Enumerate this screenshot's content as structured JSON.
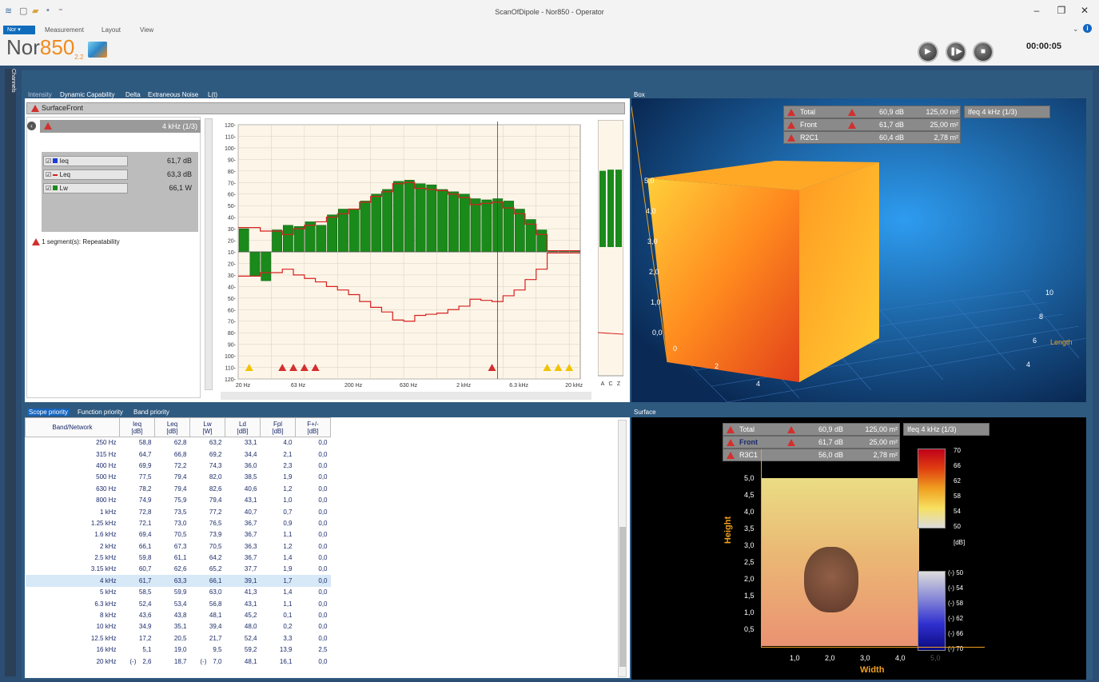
{
  "window": {
    "title": "ScanOfDipole - Nor850 - Operator"
  },
  "menu": {
    "app": "Nor",
    "items": [
      "Measurement",
      "Layout",
      "View"
    ]
  },
  "logo": {
    "text_a": "Nor",
    "text_b": "850",
    "version": "2.2"
  },
  "transport": {
    "timer": "00:00:05"
  },
  "sidebar": {
    "channels_label": "Channels"
  },
  "left_panel": {
    "tabs": [
      "Intensity",
      "Dynamic Capability",
      "Delta",
      "Extraneous Noise",
      "L(t)"
    ],
    "surface": "SurfaceFront",
    "band": "4 kHz (1/3)",
    "legend": [
      {
        "name": "Ieq",
        "value": "61,7 dB",
        "color": "#1f3bd9"
      },
      {
        "name": "Leq",
        "value": "63,3 dB",
        "color": "#d62020"
      },
      {
        "name": "Lw",
        "value": "66,1 W",
        "color": "#1a8a1a"
      }
    ],
    "repeatability": "1 segment(s): Repeatability"
  },
  "chart_data": {
    "type": "bar",
    "y_ticks": [
      "120",
      "110",
      "100",
      "90",
      "80",
      "70",
      "60",
      "50",
      "40",
      "30",
      "20",
      "10",
      "20",
      "30",
      "40",
      "50",
      "60",
      "70",
      "80",
      "90",
      "100",
      "110",
      "120"
    ],
    "x_ticks": [
      "20 Hz",
      "63 Hz",
      "200 Hz",
      "630 Hz",
      "2 kHz",
      "6.3 kHz",
      "20 kHz"
    ],
    "bands": [
      "20",
      "25",
      "31.5",
      "40",
      "50",
      "63",
      "80",
      "100",
      "125",
      "160",
      "200",
      "250",
      "315",
      "400",
      "500",
      "630",
      "800",
      "1k",
      "1.25k",
      "1.6k",
      "2k",
      "2.5k",
      "3.15k",
      "4k",
      "5k",
      "6.3k",
      "8k",
      "10k",
      "12.5k",
      "16k",
      "20k"
    ],
    "intensity": [
      40,
      -41,
      -45,
      39,
      43,
      42,
      46,
      43,
      52,
      57,
      57,
      64,
      70,
      74,
      81,
      82,
      79,
      78,
      74,
      72,
      70,
      66,
      65,
      66,
      64,
      57,
      48,
      39,
      21,
      21,
      21
    ],
    "pressure": [
      41,
      41,
      38,
      38,
      35,
      40,
      43,
      46,
      50,
      53,
      57,
      63,
      68,
      72,
      79,
      80,
      75,
      74,
      73,
      70,
      67,
      61,
      62,
      63,
      58,
      53,
      44,
      35,
      21,
      21,
      21
    ],
    "mini_labels": [
      "A",
      "C",
      "Z"
    ],
    "mini_values": [
      86,
      87,
      87
    ]
  },
  "box_panel": {
    "tab": "Box",
    "rows": [
      {
        "label": "Total",
        "value": "60,9 dB",
        "area": "125,00 m²"
      },
      {
        "label": "Front",
        "value": "61,7 dB",
        "area": "25,00 m²"
      },
      {
        "label": "R2C1",
        "value": "60,4 dB",
        "area": "2,78 m²"
      }
    ],
    "metric": "Ifeq 4 kHz (1/3)",
    "y_axis": [
      "0,0",
      "1,0",
      "2,0",
      "3,0",
      "4,0",
      "5,0"
    ],
    "x_axis": [
      "0",
      "2",
      "4"
    ],
    "z_axis": [
      "10",
      "8",
      "6",
      "4"
    ],
    "z_label": "Length"
  },
  "surface_panel": {
    "tab": "Surface",
    "rows": [
      {
        "label": "Total",
        "value": "60,9 dB",
        "area": "125,00 m²"
      },
      {
        "label": "Front",
        "value": "61,7 dB",
        "area": "25,00 m²"
      },
      {
        "label": "R3C1",
        "value": "56,0 dB",
        "area": "2,78 m²"
      }
    ],
    "metric": "Ifeq 4 kHz (1/3)",
    "y_axis": [
      "5,0",
      "4,5",
      "4,0",
      "3,5",
      "3,0",
      "2,5",
      "2,0",
      "1,5",
      "1,0",
      "0,5"
    ],
    "x_axis": [
      "1,0",
      "2,0",
      "3,0",
      "4,0",
      "5,0"
    ],
    "x_label": "Width",
    "y_label": "Height",
    "scale_pos": [
      "70",
      "66",
      "62",
      "58",
      "54",
      "50"
    ],
    "scale_unit": "[dB]",
    "scale_neg": [
      "(-) 50",
      "(-) 54",
      "(-) 58",
      "(-) 62",
      "(-) 66",
      "(-) 70"
    ]
  },
  "table": {
    "tabs": [
      "Scope priority",
      "Function priority",
      "Band priority"
    ],
    "headers": [
      "Band/Network",
      "Ieq\n[dB]",
      "Leq\n[dB]",
      "Lw\n[W]",
      "Ld\n[dB]",
      "Fpl\n[dB]",
      "F+/-\n[dB]"
    ],
    "rows": [
      [
        "250 Hz",
        "",
        "58,8",
        "62,8",
        "",
        "63,2",
        "33,1",
        "4,0",
        "0,0"
      ],
      [
        "315 Hz",
        "",
        "64,7",
        "66,8",
        "",
        "69,2",
        "34,4",
        "2,1",
        "0,0"
      ],
      [
        "400 Hz",
        "",
        "69,9",
        "72,2",
        "",
        "74,3",
        "36,0",
        "2,3",
        "0,0"
      ],
      [
        "500 Hz",
        "",
        "77,5",
        "79,4",
        "",
        "82,0",
        "38,5",
        "1,9",
        "0,0"
      ],
      [
        "630 Hz",
        "",
        "78,2",
        "79,4",
        "",
        "82,6",
        "40,6",
        "1,2",
        "0,0"
      ],
      [
        "800 Hz",
        "",
        "74,9",
        "75,9",
        "",
        "79,4",
        "43,1",
        "1,0",
        "0,0"
      ],
      [
        "1 kHz",
        "",
        "72,8",
        "73,5",
        "",
        "77,2",
        "40,7",
        "0,7",
        "0,0"
      ],
      [
        "1.25 kHz",
        "",
        "72,1",
        "73,0",
        "",
        "76,5",
        "36,7",
        "0,9",
        "0,0"
      ],
      [
        "1.6 kHz",
        "",
        "69,4",
        "70,5",
        "",
        "73,9",
        "36,7",
        "1,1",
        "0,0"
      ],
      [
        "2 kHz",
        "",
        "66,1",
        "67,3",
        "",
        "70,5",
        "36,3",
        "1,2",
        "0,0"
      ],
      [
        "2.5 kHz",
        "",
        "59,8",
        "61,1",
        "",
        "64,2",
        "36,7",
        "1,4",
        "0,0"
      ],
      [
        "3.15 kHz",
        "",
        "60,7",
        "62,6",
        "",
        "65,2",
        "37,7",
        "1,9",
        "0,0"
      ],
      [
        "4 kHz",
        "",
        "61,7",
        "63,3",
        "",
        "66,1",
        "39,1",
        "1,7",
        "0,0"
      ],
      [
        "5 kHz",
        "",
        "58,5",
        "59,9",
        "",
        "63,0",
        "41,3",
        "1,4",
        "0,0"
      ],
      [
        "6.3 kHz",
        "",
        "52,4",
        "53,4",
        "",
        "56,8",
        "43,1",
        "1,1",
        "0,0"
      ],
      [
        "8 kHz",
        "",
        "43,6",
        "43,8",
        "",
        "48,1",
        "45,2",
        "0,1",
        "0,0"
      ],
      [
        "10 kHz",
        "",
        "34,9",
        "35,1",
        "",
        "39,4",
        "48,0",
        "0,2",
        "0,0"
      ],
      [
        "12.5 kHz",
        "",
        "17,2",
        "20,5",
        "",
        "21,7",
        "52,4",
        "3,3",
        "0,0"
      ],
      [
        "16 kHz",
        "",
        "5,1",
        "19,0",
        "",
        "9,5",
        "59,2",
        "13,9",
        "2,5"
      ],
      [
        "20 kHz",
        "(-)",
        "2,6",
        "18,7",
        "(-)",
        "7,0",
        "48,1",
        "16,1",
        "0,0"
      ]
    ],
    "selected_index": 12
  }
}
